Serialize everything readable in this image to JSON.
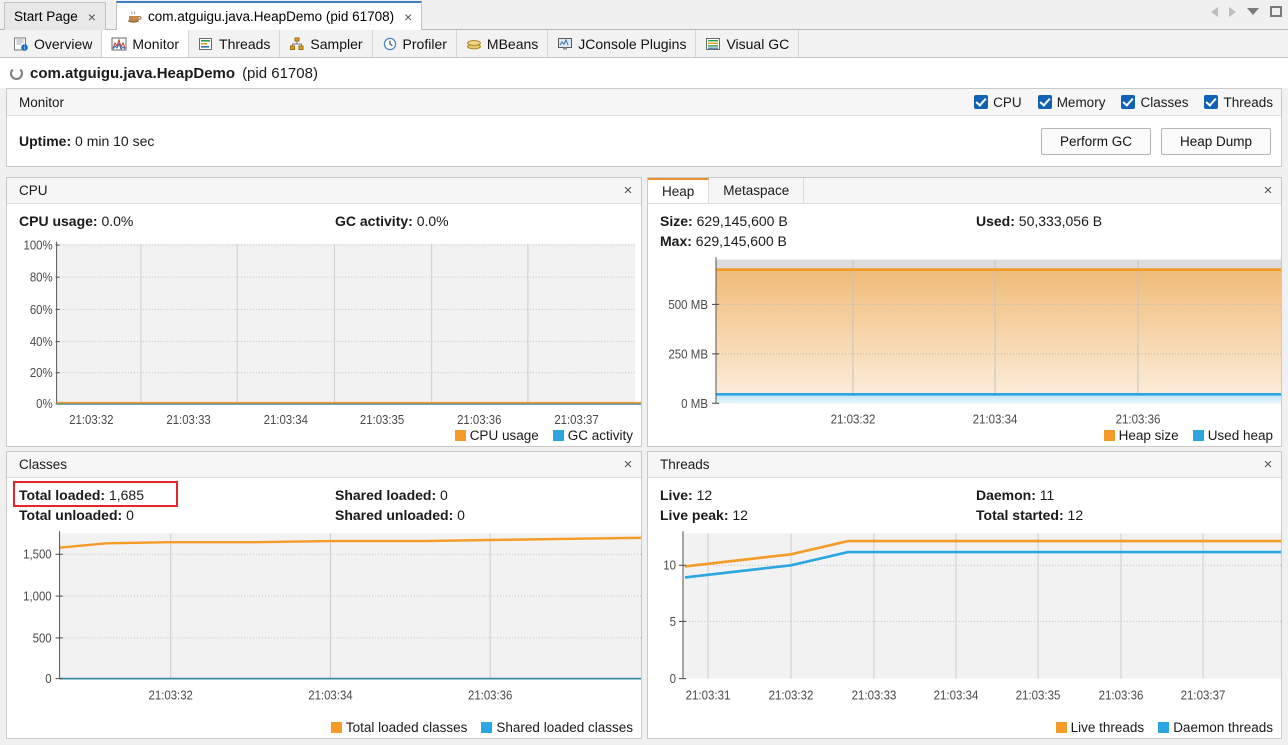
{
  "window": {
    "tabs": [
      {
        "label": "Start Page",
        "icon": "none",
        "selected": false,
        "closable": true
      },
      {
        "label": "com.atguigu.java.HeapDemo (pid 61708)",
        "icon": "java-coffee-icon",
        "selected": true,
        "closable": true
      }
    ],
    "controls": [
      "scroll-left-arrow",
      "scroll-right-arrow",
      "tab-list-chevron",
      "maximize-square"
    ]
  },
  "subtabs": [
    {
      "label": "Overview",
      "icon": "overview-icon",
      "selected": false
    },
    {
      "label": "Monitor",
      "icon": "monitor-chart-icon",
      "selected": true
    },
    {
      "label": "Threads",
      "icon": "threads-icon",
      "selected": false
    },
    {
      "label": "Sampler",
      "icon": "sampler-icon",
      "selected": false
    },
    {
      "label": "Profiler",
      "icon": "profiler-clock-icon",
      "selected": false
    },
    {
      "label": "MBeans",
      "icon": "mbeans-icon",
      "selected": false
    },
    {
      "label": "JConsole Plugins",
      "icon": "jconsole-icon",
      "selected": false
    },
    {
      "label": "Visual GC",
      "icon": "visualgc-icon",
      "selected": false
    }
  ],
  "process": {
    "name": "com.atguigu.java.HeapDemo",
    "pid": "(pid 61708)"
  },
  "monitor": {
    "title": "Monitor",
    "checkboxes": [
      {
        "label": "CPU",
        "checked": true
      },
      {
        "label": "Memory",
        "checked": true
      },
      {
        "label": "Classes",
        "checked": true
      },
      {
        "label": "Threads",
        "checked": true
      }
    ],
    "uptime_label": "Uptime:",
    "uptime_value": "0 min 10 sec",
    "perform_gc": "Perform GC",
    "heap_dump": "Heap Dump"
  },
  "cpu_panel": {
    "title": "CPU",
    "close": "×",
    "stats": [
      {
        "label": "CPU usage:",
        "value": "0.0%"
      },
      {
        "label": "GC activity:",
        "value": "0.0%"
      }
    ]
  },
  "heap_panel": {
    "tabs": [
      {
        "label": "Heap",
        "selected": true
      },
      {
        "label": "Metaspace",
        "selected": false
      }
    ],
    "close": "×",
    "stats": [
      {
        "label": "Size:",
        "value": "629,145,600 B"
      },
      {
        "label": "Used:",
        "value": "50,333,056 B"
      },
      {
        "label": "Max:",
        "value": "629,145,600 B"
      }
    ]
  },
  "classes_panel": {
    "title": "Classes",
    "close": "×",
    "highlight": "total-loaded",
    "stats": [
      {
        "label": "Total loaded:",
        "value": "1,685"
      },
      {
        "label": "Shared loaded:",
        "value": "0"
      },
      {
        "label": "Total unloaded:",
        "value": "0"
      },
      {
        "label": "Shared unloaded:",
        "value": "0"
      }
    ]
  },
  "threads_panel": {
    "title": "Threads",
    "close": "×",
    "stats": [
      {
        "label": "Live:",
        "value": "12"
      },
      {
        "label": "Daemon:",
        "value": "11"
      },
      {
        "label": "Live peak:",
        "value": "12"
      },
      {
        "label": "Total started:",
        "value": "12"
      }
    ]
  },
  "colors": {
    "orange": "#f49b28",
    "blue": "#2ca6e0",
    "highlight_red": "#e3262a",
    "accent_blue": "#0f62b5",
    "plot_bg": "#f2f2f2"
  },
  "chart_data": [
    {
      "id": "cpu-chart",
      "type": "line",
      "title": "CPU",
      "ylabel": "",
      "xlabel": "",
      "ylim": [
        0,
        100
      ],
      "yticks": [
        0,
        20,
        40,
        60,
        80,
        100
      ],
      "yticklabels": [
        "0%",
        "20%",
        "40%",
        "60%",
        "80%",
        "100%"
      ],
      "xticklabels": [
        "21:03:32",
        "21:03:33",
        "21:03:34",
        "21:03:35",
        "21:03:36",
        "21:03:37"
      ],
      "grid": true,
      "legend_position": "bottom-right",
      "series": [
        {
          "name": "CPU usage",
          "color": "#f49b28",
          "values": [
            0,
            0,
            0,
            0,
            0,
            0,
            0
          ]
        },
        {
          "name": "GC activity",
          "color": "#2ca6e0",
          "values": [
            0,
            0,
            0,
            0,
            0,
            0,
            0
          ]
        }
      ]
    },
    {
      "id": "heap-chart",
      "type": "area",
      "title": "Heap",
      "ylabel": "",
      "xlabel": "",
      "ylim": [
        0,
        700
      ],
      "yticks": [
        0,
        250,
        500
      ],
      "yticklabels": [
        "0 MB",
        "250 MB",
        "500 MB"
      ],
      "xticklabels": [
        "21:03:32",
        "21:03:34",
        "21:03:36"
      ],
      "grid": true,
      "legend_position": "bottom-right",
      "series": [
        {
          "name": "Heap size",
          "color": "#f49b28",
          "values": [
            600,
            600,
            600,
            600,
            600,
            600,
            600
          ]
        },
        {
          "name": "Used heap",
          "color": "#2ca6e0",
          "values": [
            48,
            48,
            48,
            48,
            48,
            48,
            48
          ]
        }
      ]
    },
    {
      "id": "classes-chart",
      "type": "line",
      "title": "Classes",
      "ylabel": "",
      "xlabel": "",
      "ylim": [
        0,
        1800
      ],
      "yticks": [
        0,
        500,
        1000,
        1500
      ],
      "yticklabels": [
        "0",
        "500",
        "1,000",
        "1,500"
      ],
      "xticklabels": [
        "21:03:32",
        "21:03:34",
        "21:03:36"
      ],
      "grid": true,
      "legend_position": "bottom-right",
      "series": [
        {
          "name": "Total loaded classes",
          "color": "#f49b28",
          "values": [
            1600,
            1660,
            1665,
            1668,
            1670,
            1676,
            1685
          ]
        },
        {
          "name": "Shared loaded classes",
          "color": "#2ca6e0",
          "values": [
            0,
            0,
            0,
            0,
            0,
            0,
            0
          ]
        }
      ]
    },
    {
      "id": "threads-chart",
      "type": "line",
      "title": "Threads",
      "ylabel": "",
      "xlabel": "",
      "ylim": [
        0,
        13
      ],
      "yticks": [
        0,
        5,
        10
      ],
      "yticklabels": [
        "0",
        "5",
        "10"
      ],
      "xticklabels": [
        "21:03:31",
        "21:03:32",
        "21:03:33",
        "21:03:34",
        "21:03:35",
        "21:03:36",
        "21:03:37"
      ],
      "grid": true,
      "legend_position": "bottom-right",
      "series": [
        {
          "name": "Live threads",
          "color": "#f49b28",
          "values": [
            10,
            11,
            12,
            12,
            12,
            12,
            12
          ]
        },
        {
          "name": "Daemon threads",
          "color": "#2ca6e0",
          "values": [
            9,
            10,
            11,
            11,
            11,
            11,
            11
          ]
        }
      ]
    }
  ]
}
